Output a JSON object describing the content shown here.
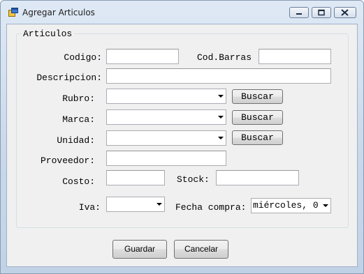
{
  "window": {
    "title": "Agregar Articulos"
  },
  "group": {
    "legend": "Articulos"
  },
  "form": {
    "codigo_label": "Codigo:",
    "codbarras_label": "Cod.Barras",
    "descripcion_label": "Descripcion:",
    "rubro_label": "Rubro:",
    "marca_label": "Marca:",
    "unidad_label": "Unidad:",
    "proveedor_label": "Proveedor:",
    "costo_label": "Costo:",
    "stock_label": "Stock:",
    "iva_label": "Iva:",
    "fecha_label": "Fecha compra:",
    "buscar_label": "Buscar",
    "fecha_value": "miércoles, 0"
  },
  "actions": {
    "guardar_label": "Guardar",
    "cancelar_label": "Cancelar"
  },
  "icons": {
    "app": "form-icon",
    "minimize": "minimize-icon",
    "maximize": "maximize-icon",
    "close": "close-icon"
  },
  "colors": {
    "title_bg": "#c9d7ea",
    "client_bg": "#f0f0f0"
  }
}
